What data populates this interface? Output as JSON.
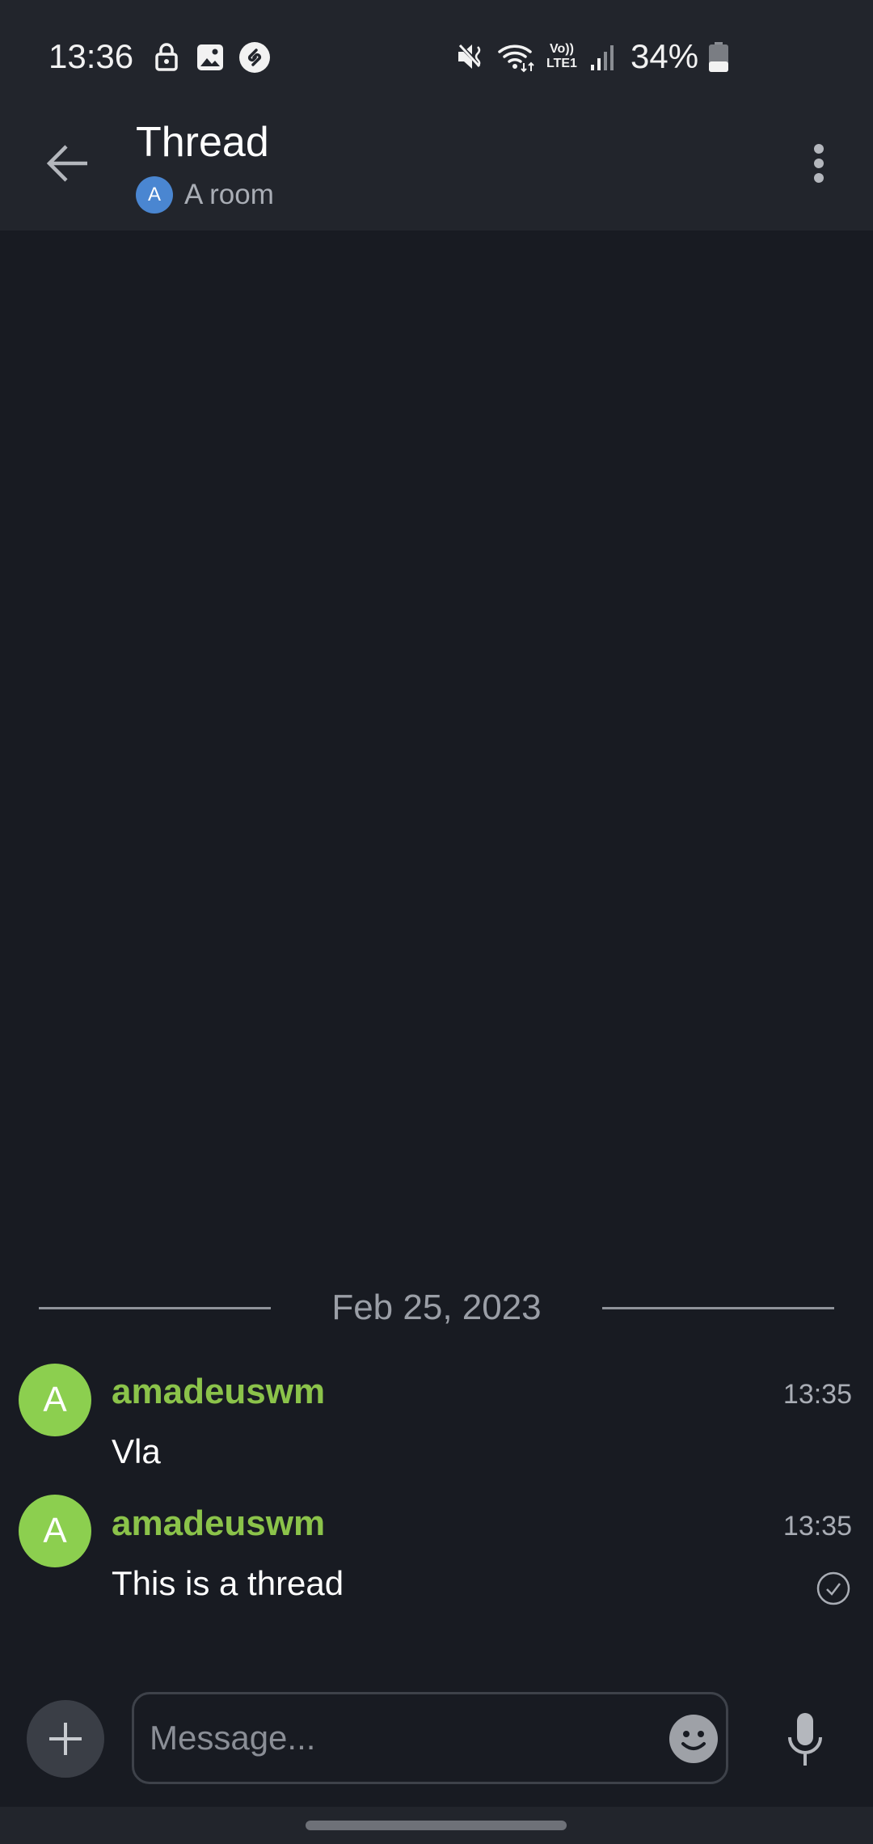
{
  "status_bar": {
    "time": "13:36",
    "left_icons": [
      "lock-icon",
      "image-icon",
      "shazam-icon"
    ],
    "right_icons": [
      "mute-icon",
      "wifi-icon",
      "volte-lte-icon",
      "signal-icon",
      "battery-icon"
    ],
    "volte_label_top": "Vo))",
    "volte_label_bottom": "LTE1",
    "battery_percent": "34%",
    "battery_level": 0.34
  },
  "toolbar": {
    "title": "Thread",
    "room_avatar_letter": "A",
    "room_name": "A room"
  },
  "timeline": {
    "date_separator": "Feb 25, 2023",
    "messages": [
      {
        "avatar_letter": "A",
        "sender": "amadeuswm",
        "time": "13:35",
        "body": "Vla"
      },
      {
        "avatar_letter": "A",
        "sender": "amadeuswm",
        "time": "13:35",
        "body": "This is a thread",
        "read_receipt": "check-circle-icon"
      }
    ]
  },
  "composer": {
    "placeholder": "Message..."
  },
  "colors": {
    "background": "#181b22",
    "bar": "#22252c",
    "sender": "#8bc34a",
    "avatar": "#8ccf4f",
    "room_avatar": "#4a86d1"
  }
}
